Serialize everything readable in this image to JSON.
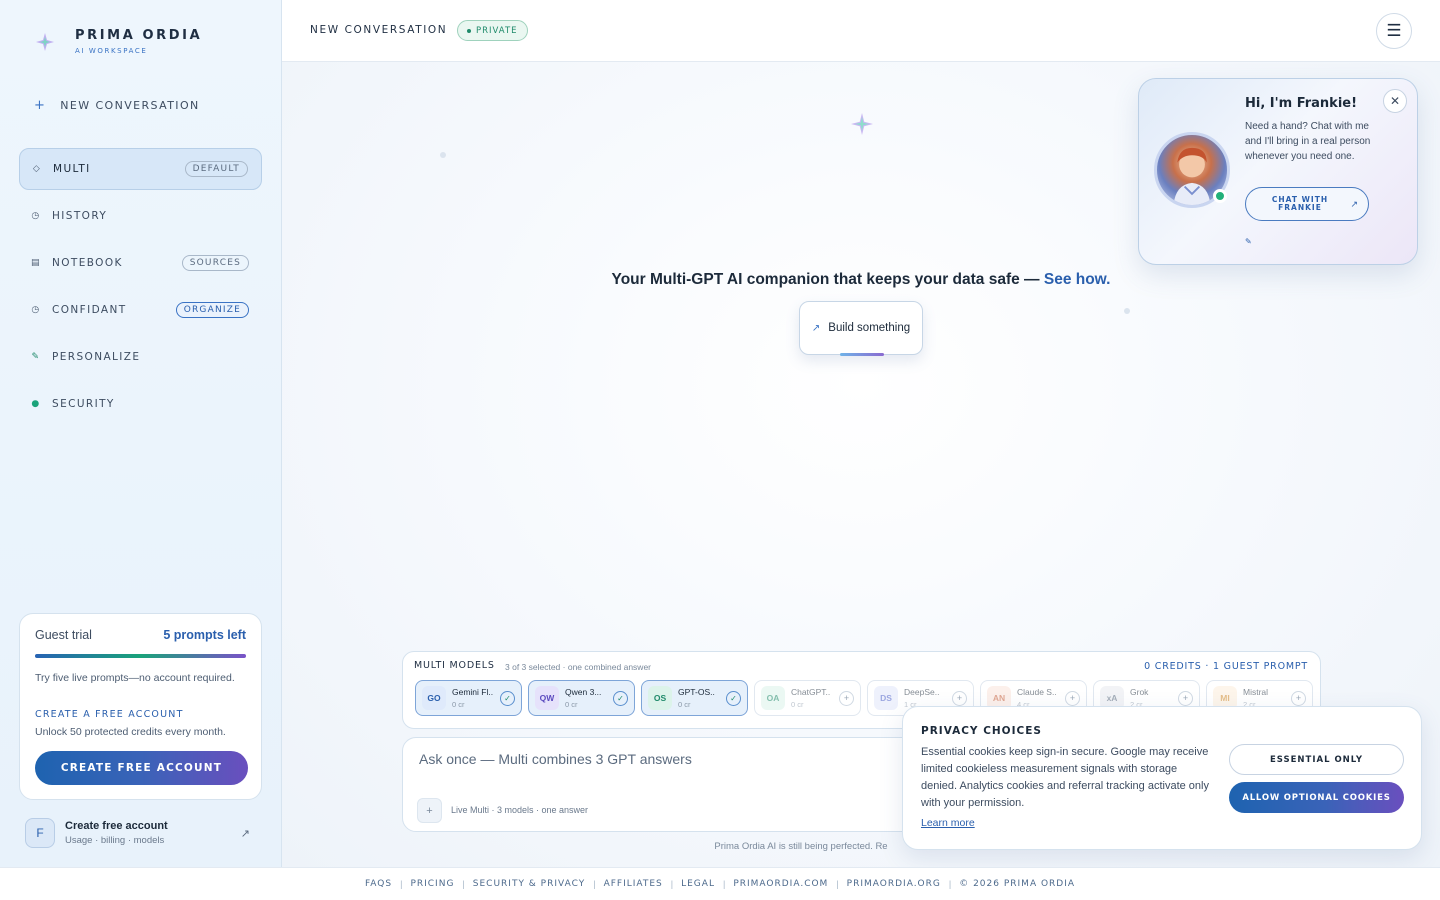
{
  "brand": {
    "name": "PRIMA ORDIA",
    "sub": "AI WORKSPACE"
  },
  "sidebar": {
    "new_conversation": "NEW CONVERSATION",
    "items": [
      {
        "label": "MULTI",
        "icon": "diamond-icon",
        "badge": "DEFAULT",
        "active": true
      },
      {
        "label": "HISTORY",
        "icon": "clock-icon",
        "badge": ""
      },
      {
        "label": "NOTEBOOK",
        "icon": "notebook-icon",
        "badge": "SOURCES"
      },
      {
        "label": "CONFIDANT",
        "icon": "confidant-icon",
        "badge": "ORGANIZE"
      },
      {
        "label": "PERSONALIZE",
        "icon": "pen-icon",
        "badge": ""
      },
      {
        "label": "SECURITY",
        "icon": "shield-dot-icon",
        "badge": ""
      }
    ]
  },
  "trial": {
    "title": "Guest trial",
    "prompts_left": "5 prompts left",
    "progress": 1.0,
    "desc": "Try five live prompts—no account required.",
    "cta_title": "CREATE A FREE ACCOUNT",
    "cta_desc": "Unlock 50 protected credits every month.",
    "button": "CREATE FREE ACCOUNT"
  },
  "account": {
    "initial": "F",
    "name": "Create free account",
    "sub": "Usage · billing · models"
  },
  "header": {
    "title": "NEW CONVERSATION",
    "badge": "PRIVATE"
  },
  "hero": {
    "text": "Your Multi-GPT AI companion that keeps your data safe — ",
    "link": "See how."
  },
  "build_button": "Build something",
  "models": {
    "title": "MULTI MODELS",
    "sub": "3 of 3 selected · one combined answer",
    "credits": "0 CREDITS · 1 GUEST PROMPT",
    "chips": [
      {
        "abbr": "GO",
        "name": "Gemini Fl..",
        "credits": "0 cr",
        "selected": true,
        "bg": "#dfeafb",
        "fg": "#2a5fad"
      },
      {
        "abbr": "QW",
        "name": "Qwen 3...",
        "credits": "0 cr",
        "selected": true,
        "bg": "#e6e2fb",
        "fg": "#5b4abf"
      },
      {
        "abbr": "OS",
        "name": "GPT-OS..",
        "credits": "0 cr",
        "selected": true,
        "bg": "#dcf3ea",
        "fg": "#1f8a6a"
      },
      {
        "abbr": "OA",
        "name": "ChatGPT..",
        "credits": "0 cr",
        "selected": false,
        "bg": "#dcf3ea",
        "fg": "#1f8a6a"
      },
      {
        "abbr": "DS",
        "name": "DeepSe..",
        "credits": "1 cr",
        "selected": false,
        "bg": "#e1e6fb",
        "fg": "#4a5fc8"
      },
      {
        "abbr": "AN",
        "name": "Claude S..",
        "credits": "4 cr",
        "selected": false,
        "bg": "#fbe4dc",
        "fg": "#c8603a"
      },
      {
        "abbr": "xA",
        "name": "Grok",
        "credits": "2 cr",
        "selected": false,
        "bg": "#e8ebef",
        "fg": "#5b6b7f"
      },
      {
        "abbr": "MI",
        "name": "Mistral",
        "credits": "2 cr",
        "selected": false,
        "bg": "#fdeedb",
        "fg": "#d08a2a"
      }
    ]
  },
  "composer": {
    "placeholder": "Ask once — Multi combines 3 GPT answers",
    "status": "Live Multi · 3 models · one answer"
  },
  "disclaimer": "Prima Ordia AI is still being perfected. Re",
  "frankie": {
    "title": "Hi, I'm Frankie!",
    "desc": "Need a hand? Chat with me and I'll bring in a real person whenever you need one.",
    "button": "CHAT WITH FRANKIE"
  },
  "privacy": {
    "title": "PRIVACY CHOICES",
    "text": "Essential cookies keep sign-in secure. Google may receive limited cookieless measurement signals with storage denied. Analytics cookies and referral tracking activate only with your permission.",
    "learn": "Learn more",
    "essential": "ESSENTIAL ONLY",
    "allow": "ALLOW OPTIONAL COOKIES"
  },
  "footer": {
    "links": [
      "FAQS",
      "PRICING",
      "SECURITY & PRIVACY",
      "AFFILIATES",
      "LEGAL",
      "PRIMAORDIA.COM",
      "PRIMAORDIA.ORG",
      "© 2026 PRIMA ORDIA"
    ]
  }
}
